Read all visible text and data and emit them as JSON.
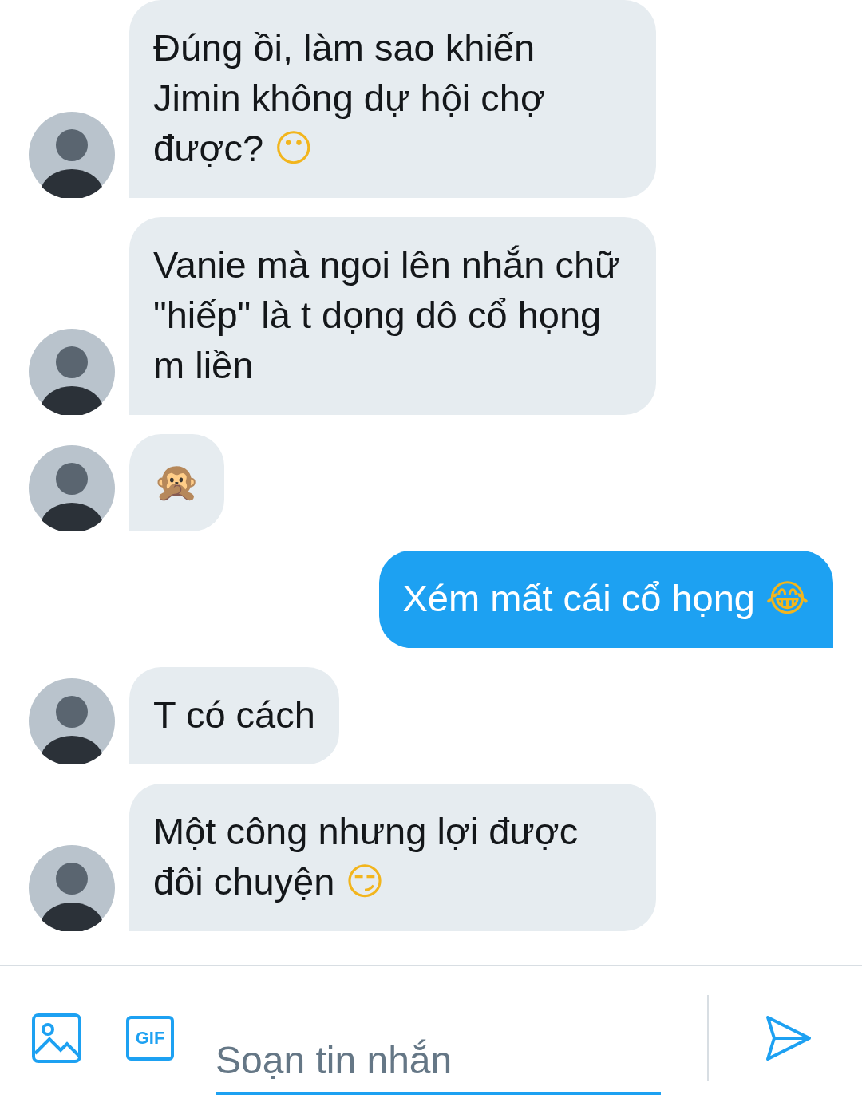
{
  "messages": [
    {
      "kind": "incoming",
      "text": "Đúng ồi, làm sao khiến Jimin không dự hội chợ được?",
      "emoji": "😶"
    },
    {
      "kind": "incoming",
      "text": "Vanie mà ngoi lên nhắn chữ \"hiếp\" là t dọng dô cổ họng m liền"
    },
    {
      "kind": "incoming",
      "emoji": "🙊"
    },
    {
      "kind": "outgoing",
      "text": "Xém mất cái cổ họng",
      "emoji": "😂"
    },
    {
      "kind": "incoming",
      "text": "T có cách"
    },
    {
      "kind": "incoming",
      "text": "Một công nhưng lợi được đôi chuyện",
      "emoji": "😏"
    }
  ],
  "composer": {
    "placeholder": "Soạn tin nhắn",
    "gif_label": "GIF"
  }
}
